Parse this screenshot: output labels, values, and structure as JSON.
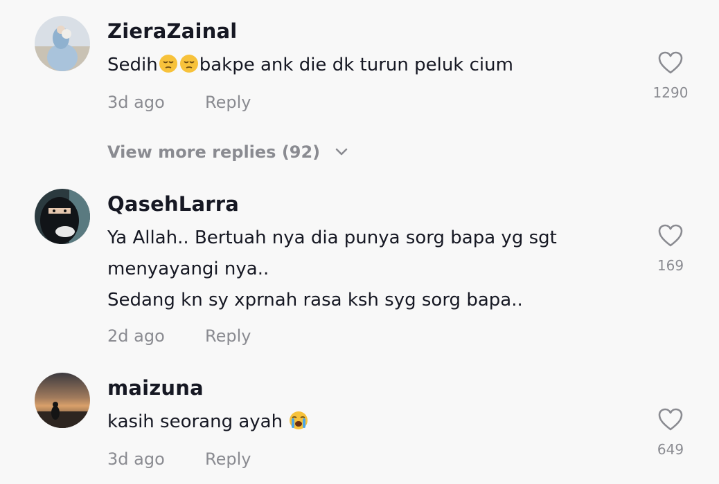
{
  "comments": [
    {
      "username": "ZieraZainal",
      "text_before_emoji": "Sedih",
      "text_after_emoji": "bakpe ank die dk turun peluk cium",
      "emoji": "pensive-face-emoji",
      "time": "3d ago",
      "reply_label": "Reply",
      "likes": "1290"
    },
    {
      "username": "QasehLarra",
      "lines": [
        "Ya Allah.. Bertuah nya dia punya sorg bapa yg sgt",
        "menyayangi nya..",
        "Sedang kn sy xprnah rasa ksh syg sorg bapa.."
      ],
      "time": "2d ago",
      "reply_label": "Reply",
      "likes": "169"
    },
    {
      "username": "maizuna",
      "text": "kasih seorang ayah ",
      "emoji": "loudly-crying-face-emoji",
      "time": "3d ago",
      "reply_label": "Reply",
      "likes": "649"
    }
  ],
  "more_replies": {
    "label": "View more replies (92)",
    "icon": "chevron-down-icon"
  },
  "colors": {
    "background": "#f8f8f8",
    "primary_text": "#161823",
    "secondary_text": "#8a8b91"
  }
}
